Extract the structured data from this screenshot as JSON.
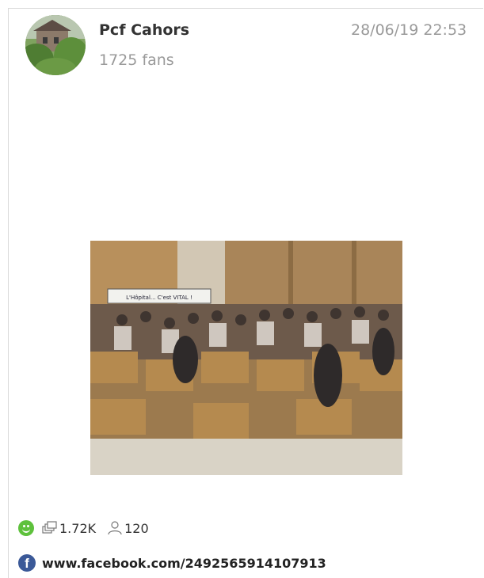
{
  "post": {
    "author_name": "Pcf Cahors",
    "fans": "1725 fans",
    "date": "28/06/19 22:53",
    "avatar_icon": "avatar-photo",
    "image_alt_icon": "photo-auditorium-meeting",
    "banner_text": "L'Hôpital... C'est VITAL !"
  },
  "stats": {
    "sentiment_icon": "smile-icon",
    "shares_icon": "shares-icon",
    "shares": "1.72K",
    "reach_icon": "people-icon",
    "people": "120"
  },
  "source": {
    "icon": "facebook-icon",
    "fb_letter": "f",
    "url": "www.facebook.com/2492565914107913"
  },
  "colors": {
    "sentiment": "#5ec13c",
    "facebook": "#3b5998",
    "muted_text": "#9a9a9a"
  }
}
